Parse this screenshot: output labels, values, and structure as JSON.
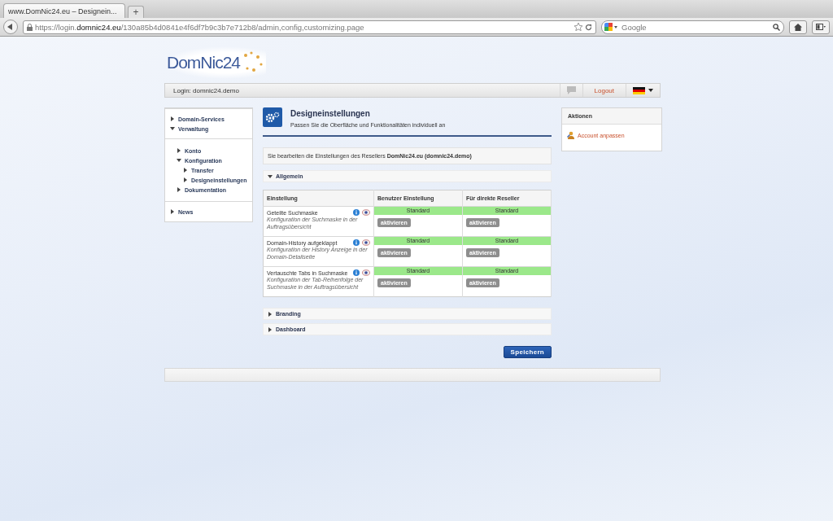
{
  "browser": {
    "tab_title": "www.DomNic24.eu – Designein...",
    "new_tab": "+",
    "url_prefix": "https://login.",
    "url_domain": "domnic24.eu",
    "url_path": "/130a85b4d0841e4f6df7b9c3b7e712b8/admin,config,customizing.page",
    "search_placeholder": "Google"
  },
  "logo": "DomNic24",
  "login_bar": {
    "login": "Login: domnic24.demo",
    "logout": "Logout"
  },
  "sidebar": {
    "groups": [
      {
        "items": [
          {
            "label": "Domain-Services",
            "expanded": false
          },
          {
            "label": "Verwaltung",
            "expanded": true
          }
        ]
      },
      {
        "items": [
          {
            "label": "Konto",
            "expanded": false
          },
          {
            "label": "Konfiguration",
            "expanded": true,
            "children": [
              {
                "label": "Transfer",
                "expanded": false
              },
              {
                "label": "Designeinstellungen",
                "expanded": false
              }
            ]
          },
          {
            "label": "Dokumentation",
            "expanded": false
          }
        ]
      },
      {
        "items": [
          {
            "label": "News",
            "expanded": false
          }
        ]
      }
    ]
  },
  "page": {
    "title": "Designeinstellungen",
    "subtitle": "Passen Sie die Oberfläche und Funktionalitäten individuell an",
    "notice": "Sie bearbeiten die Einstellungen des Resellers **DomNic24.eu (domnic24.demo)**"
  },
  "sections": [
    {
      "title": "Allgemein",
      "expanded": true,
      "table": {
        "columns": [
          "Einstellung",
          "Benutzer Einstellung",
          "Für direkte Reseller"
        ],
        "rows": [
          {
            "name": "Geteilte Suchmaske",
            "description": "Konfiguration der Suchmaske in der Auftragsübersicht",
            "values": [
              {
                "status": "Standard",
                "button": "aktivieren",
                "disabled": true
              },
              {
                "status": "Standard",
                "button": "aktivieren",
                "disabled": true
              }
            ]
          },
          {
            "name": "Domain-History aufgeklappt",
            "description": "Konfiguration der History Anzeige in der Domain-Detailseite",
            "values": [
              {
                "status": "Standard",
                "button": "aktivieren",
                "disabled": true
              },
              {
                "status": "Standard",
                "button": "aktivieren",
                "disabled": true
              }
            ]
          },
          {
            "name": "Vertauschte Tabs in Suchmaske",
            "description": "Konfiguration der Tab-Reihenfolge der Suchmaske in der Auftragsübersicht",
            "values": [
              {
                "status": "Standard",
                "button": "aktivieren",
                "disabled": true
              },
              {
                "status": "Standard",
                "button": "aktivieren",
                "disabled": true
              }
            ]
          }
        ]
      }
    },
    {
      "title": "Branding",
      "expanded": false
    },
    {
      "title": "Dashboard",
      "expanded": false
    }
  ],
  "save_button": "Speichern",
  "actions": {
    "title": "Aktionen",
    "items": [
      "Account anpassen"
    ]
  }
}
